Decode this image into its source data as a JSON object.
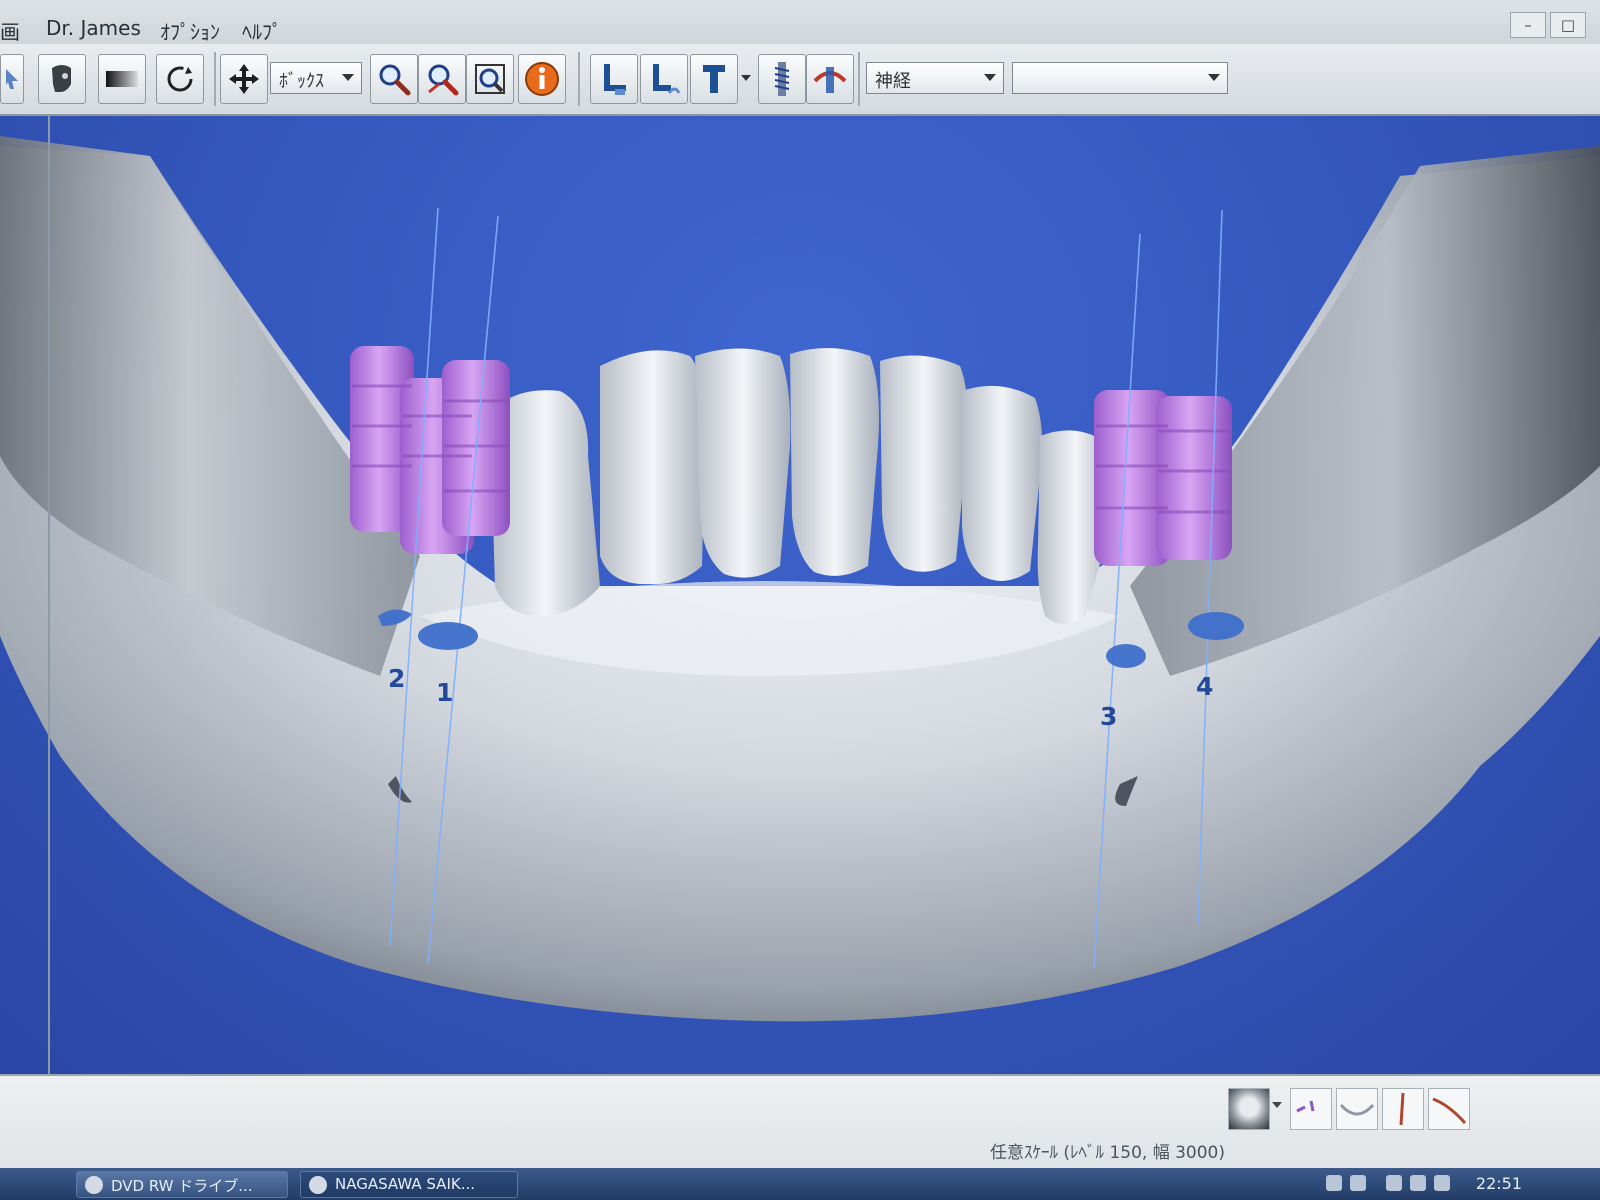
{
  "menubar": {
    "items": [
      "画",
      "Dr. James",
      "ｵﾌﾟｼｮﾝ",
      "ﾍﾙﾌﾟ"
    ]
  },
  "toolbar": {
    "box_select_value": "ﾎﾞｯｸｽ",
    "structure_select_value": "神経",
    "extra_select_value": ""
  },
  "viewport": {
    "implant_labels": [
      "1",
      "2",
      "3",
      "4"
    ],
    "background_color": "#3559bf",
    "implant_color": "#b77be0",
    "trajectory_color": "#6fa3ff"
  },
  "bottom": {
    "status": "任意ｽｹｰﾙ (ﾚﾍﾞﾙ 150, 幅 3000)"
  },
  "taskbar": {
    "tasks": [
      "DVD RW ドライブ...",
      "NAGASAWA SAIK..."
    ],
    "clock": "22:51"
  }
}
